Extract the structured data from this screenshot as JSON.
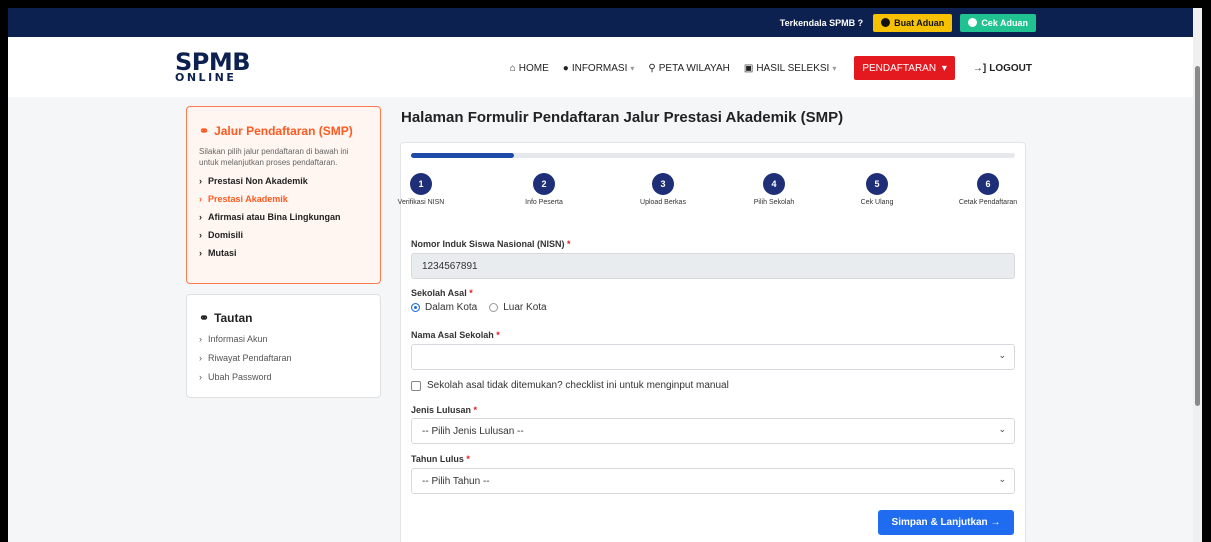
{
  "topbar": {
    "question": "Terkendala SPMB ?",
    "buat_aduan": "Buat Aduan",
    "cek_aduan": "Cek Aduan"
  },
  "logo": {
    "line1": "SPMB",
    "line2": "ONLINE"
  },
  "nav": {
    "home": "HOME",
    "informasi": "INFORMASI",
    "peta": "PETA WILAYAH",
    "hasil": "HASIL SELEKSI",
    "pendaftaran": "PENDAFTARAN",
    "logout": "LOGOUT"
  },
  "sidebar": {
    "title": "Jalur Pendaftaran (SMP)",
    "desc": "Silakan pilih jalur pendaftaran di bawah ini untuk melanjutkan proses pendaftaran.",
    "items": [
      {
        "label": "Prestasi Non Akademik",
        "active": false
      },
      {
        "label": "Prestasi Akademik",
        "active": true
      },
      {
        "label": "Afirmasi atau Bina Lingkungan",
        "active": false
      },
      {
        "label": "Domisili",
        "active": false
      },
      {
        "label": "Mutasi",
        "active": false
      }
    ]
  },
  "links": {
    "title": "Tautan",
    "items": [
      "Informasi Akun",
      "Riwayat Pendaftaran",
      "Ubah Password"
    ]
  },
  "page_title": "Halaman Formulir Pendaftaran Jalur Prestasi Akademik (SMP)",
  "progress": {
    "percent": 17
  },
  "steps": [
    {
      "n": "1",
      "label": "Verifikasi NISN"
    },
    {
      "n": "2",
      "label": "Info Peserta"
    },
    {
      "n": "3",
      "label": "Upload Berkas"
    },
    {
      "n": "4",
      "label": "Pilih Sekolah"
    },
    {
      "n": "5",
      "label": "Cek Ulang"
    },
    {
      "n": "6",
      "label": "Cetak Pendaftaran"
    }
  ],
  "form": {
    "nisn_label": "Nomor Induk Siswa Nasional (NISN)",
    "nisn_value": "1234567891",
    "sekolah_asal_label": "Sekolah Asal",
    "radio_dalam": "Dalam Kota",
    "radio_luar": "Luar Kota",
    "nama_sekolah_label": "Nama Asal Sekolah",
    "nama_sekolah_value": "",
    "manual_checkbox": "Sekolah asal tidak ditemukan? checklist ini untuk menginput manual",
    "jenis_label": "Jenis Lulusan",
    "jenis_value": "-- Pilih Jenis Lulusan --",
    "tahun_label": "Tahun Lulus",
    "tahun_value": "-- Pilih Tahun --",
    "required_mark": "*",
    "submit": "Simpan & Lanjutkan →"
  },
  "colors": {
    "navy": "#0d2150",
    "accent_orange": "#ff5a1f",
    "brand_red": "#e3191f",
    "primary_blue": "#1f6cf0",
    "step_blue": "#1e2f78"
  }
}
